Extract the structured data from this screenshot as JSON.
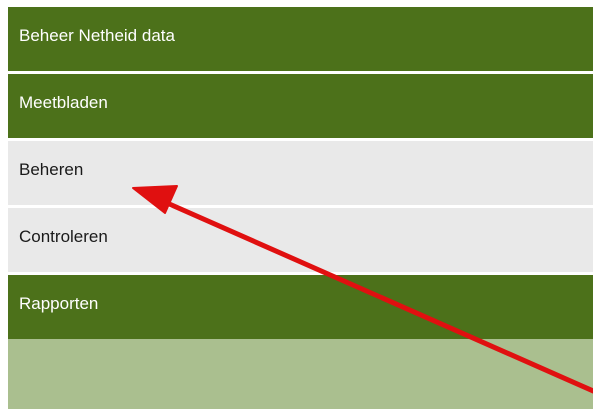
{
  "menu": {
    "items": [
      {
        "label": "Beheer Netheid data",
        "style": "green"
      },
      {
        "label": "Meetbladen",
        "style": "green"
      },
      {
        "label": "Beheren",
        "style": "grey"
      },
      {
        "label": "Controleren",
        "style": "grey"
      },
      {
        "label": "Rapporten",
        "style": "green"
      }
    ]
  },
  "colors": {
    "menu_green": "#4c711a",
    "menu_grey": "#e9e9e9",
    "footer_panel": "#aabf8f",
    "annotation_arrow": "#e01010"
  },
  "annotation": {
    "type": "arrow",
    "points_to": "Beheren"
  }
}
